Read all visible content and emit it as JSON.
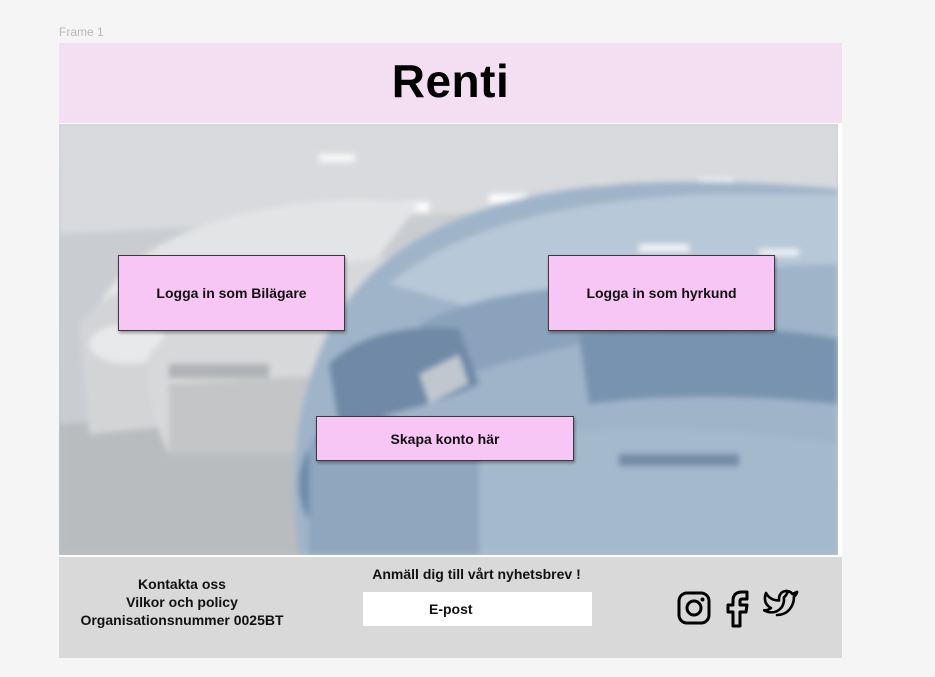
{
  "canvas": {
    "frame_label": "Frame 1"
  },
  "header": {
    "brand": "Renti"
  },
  "hero": {
    "buttons": {
      "owner_login": "Logga in som Bilägare",
      "renter_login": "Logga in som hyrkund",
      "create_account": "Skapa konto här"
    }
  },
  "footer": {
    "contact": {
      "line1": "Kontakta oss",
      "line2": "Vilkor och policy",
      "line3": "Organisationsnummer 0025BT"
    },
    "newsletter": {
      "heading": "Anmäll dig till vårt nyhetsbrev !",
      "email_placeholder": "E-post",
      "email_value": ""
    },
    "social": [
      {
        "icon": "instagram-icon"
      },
      {
        "icon": "facebook-icon"
      },
      {
        "icon": "twitter-icon"
      }
    ]
  },
  "colors": {
    "header_bg": "#f4def2",
    "button_bg": "#f7c6f4",
    "footer_bg": "#d9d9d9",
    "canvas_bg": "#f5f5f5"
  }
}
